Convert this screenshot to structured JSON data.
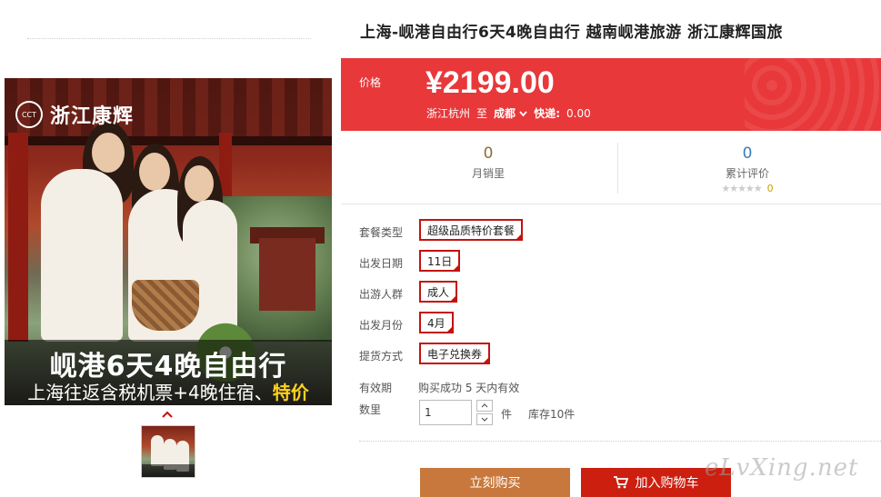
{
  "product": {
    "title": "上海-岘港自由行6天4晚自由行 越南岘港旅游 浙江康辉国旅",
    "image": {
      "logo_mark": "CCT",
      "logo_text": "浙江康辉",
      "headline": "岘港6天4晚自由行",
      "subline": "上海往返含税机票+4晚住宿、",
      "subline_highlight": "特价"
    }
  },
  "price": {
    "label": "价格",
    "value": "¥2199.00",
    "origin": "浙江杭州",
    "to": "至",
    "destination": "成都",
    "shipping_label": "快递:",
    "shipping_value": "0.00"
  },
  "stats": {
    "monthly_sales": "0",
    "monthly_sales_label": "月销里",
    "reviews": "0",
    "reviews_label": "累计评价",
    "stars": "★★★★★",
    "rating_count": "0"
  },
  "options": [
    {
      "label": "套餐类型",
      "value": "超级品质特价套餐"
    },
    {
      "label": "出发日期",
      "value": "11日"
    },
    {
      "label": "出游人群",
      "value": "成人"
    },
    {
      "label": "出发月份",
      "value": "4月"
    },
    {
      "label": "提货方式",
      "value": "电子兑换券"
    }
  ],
  "validity": {
    "label": "有效期",
    "value": "购买成功 5 天内有效"
  },
  "quantity": {
    "label": "数里",
    "value": "1",
    "unit": "件",
    "stock": "库存10件"
  },
  "buttons": {
    "buy_now": "立刻购买",
    "add_to_cart": "加入购物车"
  },
  "watermark": "eLvXing.net",
  "icons": {
    "cart": "cart-icon",
    "chevron": "chevron-down-icon",
    "thumb_up": "chevron-up-icon"
  },
  "colors": {
    "price_bg": "#e8383a",
    "accent_red": "#c4120e",
    "buy_button": "#c8783c",
    "cart_button": "#cc1f10"
  }
}
